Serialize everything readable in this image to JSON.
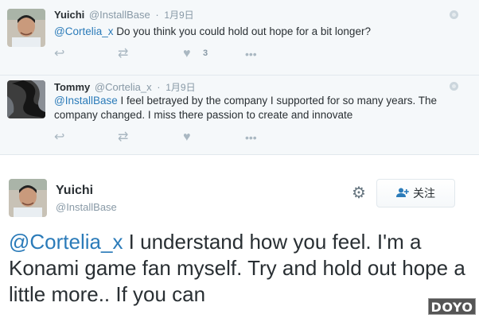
{
  "replies": [
    {
      "name": "Yuichi",
      "handle": "@InstallBase",
      "dot": "·",
      "time": "1月9日",
      "mention": "@Cortelia_x",
      "text": " Do you think you could hold out hope for a bit longer?",
      "like_count": "3"
    },
    {
      "name": "Tommy",
      "handle": "@Cortelia_x",
      "dot": "·",
      "time": "1月9日",
      "mention": "@InstallBase",
      "text": " I feel betrayed by the company I supported for so many years. The company changed. I miss there passion to create and innovate",
      "like_count": ""
    }
  ],
  "main_tweet": {
    "name": "Yuichi",
    "handle": "@InstallBase",
    "follow_label": "关注",
    "mention": "@Cortelia_x",
    "text": " I understand how you feel. I'm a Konami game fan myself. Try and hold out hope a little more.. If you can"
  },
  "icons": {
    "reply": "reply-icon",
    "retweet": "retweet-icon",
    "like": "heart-icon",
    "more": "more-icon",
    "globe": "globe-icon",
    "gear": "gear-icon",
    "follow": "add-user-icon"
  },
  "watermark": "DOYO",
  "colors": {
    "link": "#2b7bb9",
    "reply_bg": "#f5f8fa",
    "muted": "#8899a6",
    "icon": "#aab8c2"
  }
}
